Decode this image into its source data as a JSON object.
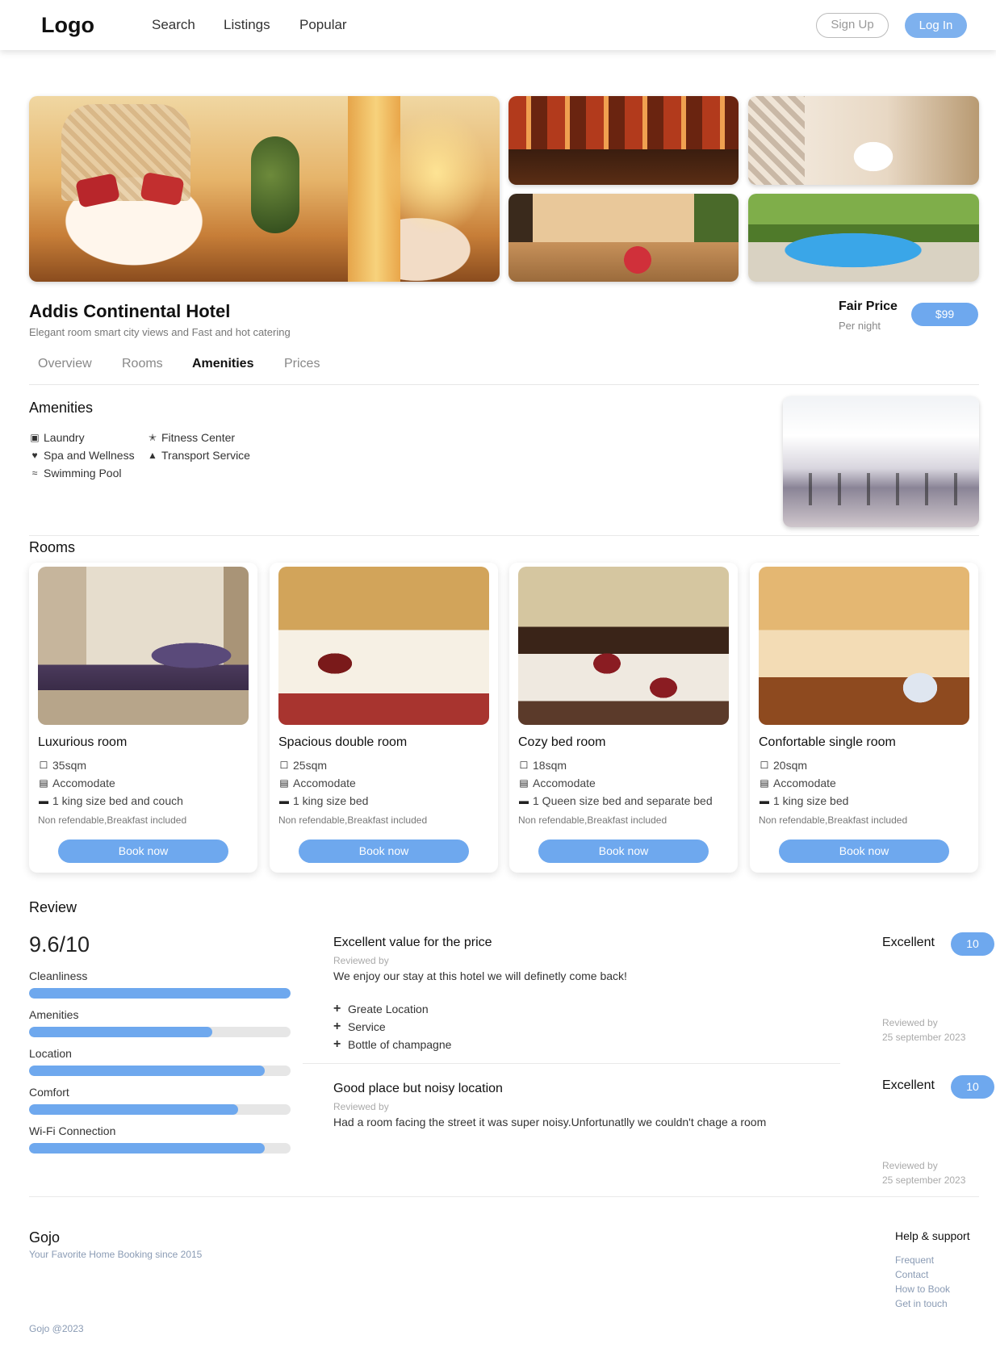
{
  "nav": {
    "logo": "Logo",
    "links": [
      "Search",
      "Listings",
      "Popular"
    ],
    "signup": "Sign Up",
    "login": "Log In"
  },
  "hotel": {
    "name": "Addis Continental Hotel",
    "subtitle": "Elegant room smart city views and Fast and hot catering",
    "price_label": "Fair Price",
    "price_unit": "Per night",
    "price": "$99"
  },
  "tabs": [
    "Overview",
    "Rooms",
    "Amenities",
    "Prices"
  ],
  "active_tab": "Amenities",
  "amenities": {
    "title": "Amenities",
    "items": [
      {
        "icon": "laundry-icon",
        "label": "Laundry"
      },
      {
        "icon": "fitness-icon",
        "label": "Fitness Center"
      },
      {
        "icon": "spa-icon",
        "label": "Spa and Wellness"
      },
      {
        "icon": "car-icon",
        "label": "Transport Service"
      },
      {
        "icon": "pool-icon",
        "label": "Swimming Pool"
      }
    ]
  },
  "rooms": {
    "title": "Rooms",
    "items": [
      {
        "name": "Luxurious room",
        "size": "35sqm",
        "accommodate": "Accomodate",
        "bed": "1 king size bed and couch",
        "note": "Non refendable,Breakfast included",
        "cta": "Book now"
      },
      {
        "name": "Spacious double room",
        "size": "25sqm",
        "accommodate": "Accomodate",
        "bed": "1 king size bed",
        "note": "Non refendable,Breakfast included",
        "cta": "Book now"
      },
      {
        "name": "Cozy bed room",
        "size": "18sqm",
        "accommodate": "Accomodate",
        "bed": "1 Queen size bed and separate bed",
        "note": "Non refendable,Breakfast included",
        "cta": "Book now"
      },
      {
        "name": "Confortable single room",
        "size": "20sqm",
        "accommodate": "Accomodate",
        "bed": "1 king size bed",
        "note": "Non refendable,Breakfast included",
        "cta": "Book now"
      }
    ]
  },
  "review": {
    "title": "Review",
    "score": "9.6/10",
    "categories": [
      {
        "label": "Cleanliness",
        "value": 1.0
      },
      {
        "label": "Amenities",
        "value": 0.7
      },
      {
        "label": "Location",
        "value": 0.9
      },
      {
        "label": "Comfort",
        "value": 0.8
      },
      {
        "label": "Wi-Fi Connection",
        "value": 0.9
      }
    ],
    "entries": [
      {
        "title": "Excellent value for the price",
        "by": "Reviewed by",
        "text": "We enjoy our stay at this hotel we will definetly come back!",
        "pros": [
          "Greate Location",
          "Service",
          "Bottle of champagne"
        ],
        "rating_label": "Excellent",
        "rating": "10",
        "meta_by": "Reviewed by",
        "date": "25 september 2023"
      },
      {
        "title": "Good place but noisy location",
        "by": "Reviewed by",
        "text": "Had a room facing the street it was super noisy.Unfortunatlly we couldn't chage a room",
        "pros": [],
        "rating_label": "Excellent",
        "rating": "10",
        "meta_by": "Reviewed by",
        "date": "25 september 2023"
      }
    ]
  },
  "footer": {
    "brand": "Gojo",
    "tagline": "Your Favorite Home Booking since 2015",
    "copyright": "Gojo @2023",
    "help_title": "Help & support",
    "help_links": [
      "Frequent",
      "Contact",
      "How to Book",
      "Get in touch"
    ]
  },
  "colors": {
    "accent": "#6ea8ee",
    "track": "#e6e6e6"
  }
}
